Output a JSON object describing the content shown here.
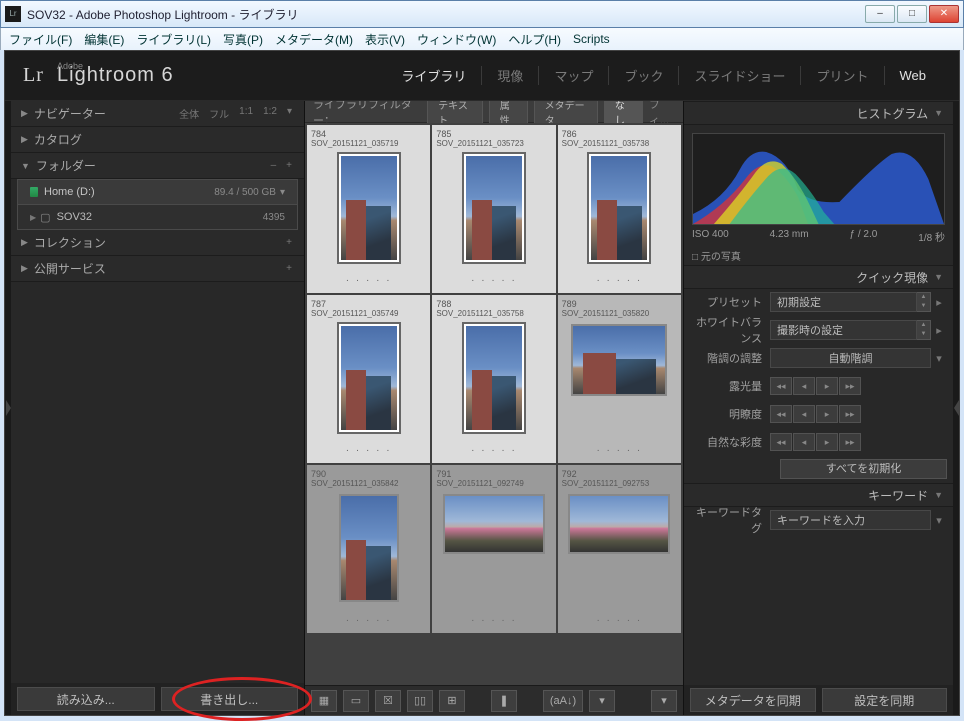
{
  "window": {
    "title": "SOV32 - Adobe Photoshop Lightroom - ライブラリ"
  },
  "menu": {
    "file": "ファイル(F)",
    "edit": "編集(E)",
    "library": "ライブラリ(L)",
    "photo": "写真(P)",
    "metadata": "メタデータ(M)",
    "view": "表示(V)",
    "window": "ウィンドウ(W)",
    "help": "ヘルプ(H)",
    "scripts": "Scripts"
  },
  "identity": {
    "brand_small": "Adobe",
    "brand_big": "Lightroom 6"
  },
  "modules": {
    "library": "ライブラリ",
    "develop": "現像",
    "map": "マップ",
    "book": "ブック",
    "slideshow": "スライドショー",
    "print": "プリント",
    "web": "Web"
  },
  "left": {
    "navigator": "ナビゲーター",
    "nav_opts": {
      "a": "全体",
      "b": "フル",
      "c": "1:1",
      "d": "1:2"
    },
    "catalog": "カタログ",
    "folders": "フォルダー",
    "volume": {
      "name": "Home (D:)",
      "usage": "89.4 / 500 GB"
    },
    "folder1": {
      "name": "SOV32",
      "count": "4395"
    },
    "collections": "コレクション",
    "publish": "公開サービス",
    "import_btn": "読み込み...",
    "export_btn": "書き出し..."
  },
  "filter": {
    "label": "ライブラリフィルター：",
    "text": "テキスト",
    "attr": "属性",
    "meta": "メタデータ",
    "none": "なし",
    "flt": "フィ..."
  },
  "grid": [
    {
      "num": "784",
      "fn": "SOV_20151121_035719",
      "sel": true,
      "orient": "p"
    },
    {
      "num": "785",
      "fn": "SOV_20151121_035723",
      "sel": true,
      "orient": "p"
    },
    {
      "num": "786",
      "fn": "SOV_20151121_035738",
      "sel": true,
      "orient": "p"
    },
    {
      "num": "787",
      "fn": "SOV_20151121_035749",
      "sel": true,
      "orient": "p"
    },
    {
      "num": "788",
      "fn": "SOV_20151121_035758",
      "sel": true,
      "orient": "p"
    },
    {
      "num": "789",
      "fn": "SOV_20151121_035820",
      "sel": "cur",
      "orient": "l"
    },
    {
      "num": "790",
      "fn": "SOV_20151121_035842",
      "sel": false,
      "orient": "p"
    },
    {
      "num": "791",
      "fn": "SOV_20151121_092749",
      "sel": false,
      "orient": "lw"
    },
    {
      "num": "792",
      "fn": "SOV_20151121_092753",
      "sel": false,
      "orient": "lw"
    }
  ],
  "histogram": {
    "title": "ヒストグラム",
    "iso": "ISO 400",
    "focal": "4.23 mm",
    "aperture": "ƒ / 2.0",
    "shutter": "1/8 秒",
    "original": "元の写真"
  },
  "quickdev": {
    "title": "クイック現像",
    "preset_lbl": "プリセット",
    "preset_val": "初期設定",
    "wb_lbl": "ホワイトバランス",
    "wb_val": "撮影時の設定",
    "tone_lbl": "階調の調整",
    "autotone": "自動階調",
    "exposure": "露光量",
    "clarity": "明瞭度",
    "vibrance": "自然な彩度",
    "reset": "すべてを初期化"
  },
  "keywords": {
    "title": "キーワード",
    "tag_lbl": "キーワードタグ",
    "tag_placeholder": "キーワードを入力"
  },
  "right_bottom": {
    "sync_meta": "メタデータを同期",
    "sync_settings": "設定を同期"
  },
  "glyph": {
    "lr": "Lr",
    "sq": "□",
    "chev": "▾",
    "minus": "–",
    "plus": "+",
    "tri_r": "▶",
    "tri_d": "▼",
    "folder": "📁",
    "grid": "▦",
    "loupe": "▭",
    "xy": "☒",
    "cmp": "▯▯",
    "survey": "⊞",
    "spray": "❚",
    "sort": "(aA↓)",
    "dots5": "· · · · ·"
  }
}
